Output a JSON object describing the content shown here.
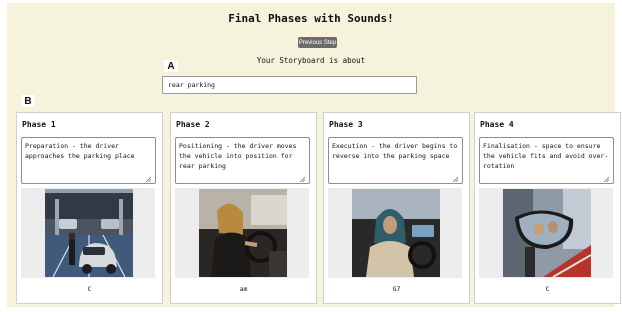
{
  "header": {
    "title": "Final Phases with Sounds!",
    "prev_button": "Previous Step",
    "about_label": "Your Storyboard is about"
  },
  "markers": {
    "a": "A",
    "b": "B"
  },
  "topic": {
    "value": "rear parking"
  },
  "phases": [
    {
      "title": "Phase 1",
      "text": "Preparation - the driver approaches the parking place",
      "sound": "C",
      "image_icon": "parking-garage-scene"
    },
    {
      "title": "Phase 2",
      "text": "Positioning - the driver moves the vehicle into position for rear parking",
      "sound": "am",
      "image_icon": "driver-turning-scene"
    },
    {
      "title": "Phase 3",
      "text": "Execution - the driver begins to reverse into the parking space",
      "sound": "G7",
      "image_icon": "driver-reversing-scene"
    },
    {
      "title": "Phase 4",
      "text": "Finalisation - space to ensure the vehicle fits and avoid over-rotation",
      "sound": "C",
      "image_icon": "side-mirror-scene"
    }
  ],
  "colors": {
    "frame_bg": "#f5f3dc",
    "button_bg": "#6b6b6b",
    "card_border": "#cfcfcf"
  }
}
